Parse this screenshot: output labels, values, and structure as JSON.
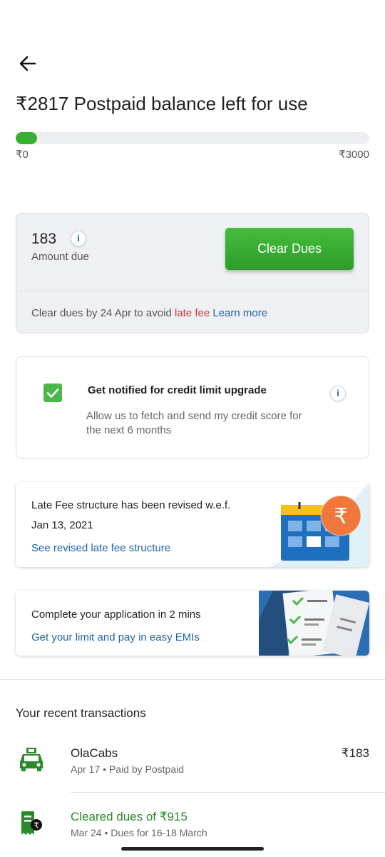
{
  "header": {
    "title": "₹2817 Postpaid balance left for use",
    "progress_fraction": 0.061,
    "min_label": "₹0",
    "max_label": "₹3000"
  },
  "due_card": {
    "amount": "183",
    "amount_label": "Amount due",
    "info_glyph": "i",
    "button_label": "Clear Dues",
    "note_prefix": "Clear dues by 24 Apr to avoid ",
    "note_late": "late fee",
    "note_link": "Learn more"
  },
  "notify_card": {
    "checked": true,
    "title": "Get notified for credit limit upgrade",
    "description": "Allow us to fetch and send my credit score for the next 6 months",
    "info_glyph": "i"
  },
  "late_fee_card": {
    "line1": "Late Fee structure has been revised w.e.f.",
    "line2": "Jan 13, 2021",
    "link": "See revised late fee structure",
    "rupee_glyph": "₹"
  },
  "application_card": {
    "line1": "Complete your application in 2 mins",
    "link": "Get your limit and pay in easy EMIs"
  },
  "transactions": {
    "heading": "Your recent transactions",
    "items": [
      {
        "name": "OlaCabs",
        "sub": "Apr 17 • Paid by Postpaid",
        "amount": "₹183",
        "icon": "car-icon"
      },
      {
        "name": "Cleared dues of ₹915",
        "sub": "Mar 24 • Dues for 16-18 March",
        "amount": "",
        "icon": "receipt-rupee-icon"
      }
    ]
  },
  "colors": {
    "accent_green": "#38b033",
    "link_blue": "#1e64a8",
    "late_red": "#d23a3a",
    "rupee_orange": "#f0783c"
  }
}
